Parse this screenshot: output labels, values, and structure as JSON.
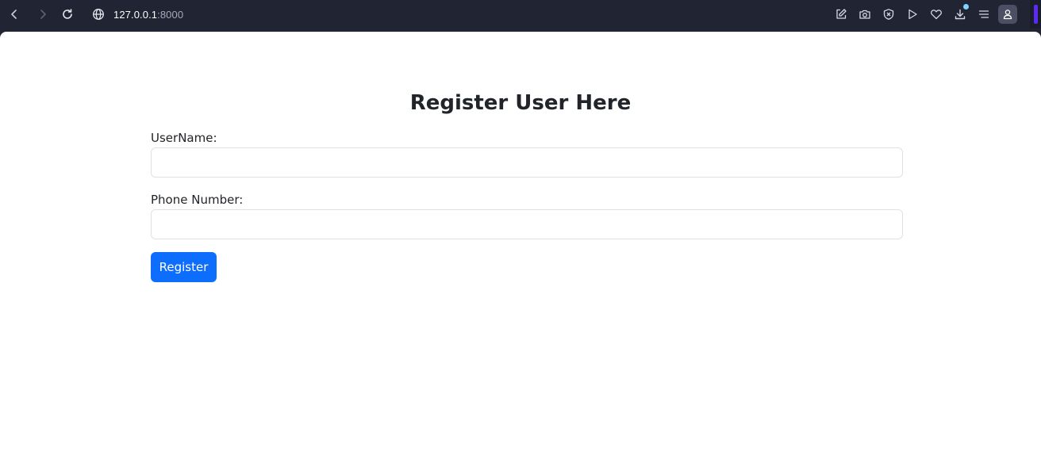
{
  "browser": {
    "url_host": "127.0.0.1",
    "url_port": ":8000",
    "icons": {
      "back": "chevron-left-icon",
      "forward": "chevron-right-icon",
      "reload": "reload-icon",
      "site": "globe-icon",
      "edit": "edit-icon",
      "screenshot": "camera-icon",
      "shield": "shield-icon",
      "play": "play-icon",
      "favorite": "heart-icon",
      "download": "download-icon",
      "menu": "menu-icon",
      "profile": "profile-icon"
    },
    "colors": {
      "toolbar": "#202433",
      "download_badge": "#7fd3ff",
      "sidebar_accent": "#5b2bf3"
    }
  },
  "page": {
    "title": "Register User Here",
    "form": {
      "username_label": "UserName:",
      "username_value": "",
      "phone_label": "Phone Number:",
      "phone_value": "",
      "submit_label": "Register"
    },
    "colors": {
      "primary_button": "#0d6efd",
      "text": "#212529",
      "input_border": "#dee2e6"
    }
  }
}
